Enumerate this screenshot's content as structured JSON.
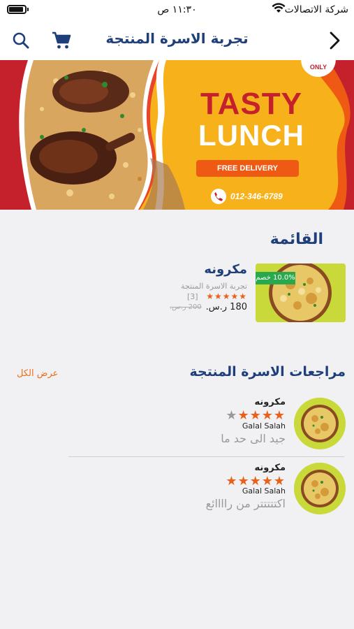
{
  "status_bar": {
    "time": "١١:٣٠ ص",
    "carrier": "شركة الاتصالات"
  },
  "header": {
    "title": "تجربة الاسرة المنتجة"
  },
  "banner": {
    "headline_1": "TASTY",
    "headline_2": "LUNCH",
    "delivery_label": "FREE DELIVERY",
    "phone": "012-346-6789",
    "badge_text": "ONLY"
  },
  "menu": {
    "title": "القائمة",
    "product": {
      "name": "مكرونه",
      "family": "تجربة الاسرة المنتجة",
      "rating": 5,
      "rating_count": "[3]",
      "price": "180 ر.س.",
      "old_price": "200 ر.س.",
      "discount": "10.0% خصم"
    }
  },
  "reviews": {
    "title": "مراجعات الاسرة المنتجة",
    "view_all": "عرض الكل",
    "items": [
      {
        "product": "مكرونه",
        "author": "Galal Salah",
        "rating": 4,
        "text": "جيد الى حد ما"
      },
      {
        "product": "مكرونه",
        "author": "Galal Salah",
        "rating": 5,
        "text": "اكتتتتتر من راااائع"
      }
    ]
  },
  "colors": {
    "primary": "#1f3f7a",
    "accent": "#ee6e1c",
    "star": "#e8611a",
    "discount": "#29a84d",
    "banner_yellow": "#f7b21b",
    "banner_red": "#e8452a"
  }
}
